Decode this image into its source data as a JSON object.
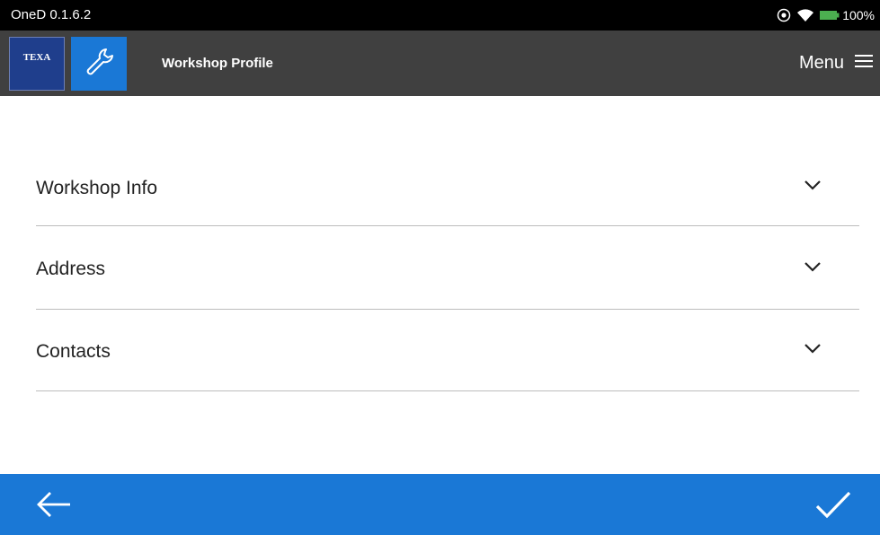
{
  "status_bar": {
    "app_version": "OneD 0.1.6.2",
    "battery_percent": "100%",
    "battery_color": "#4caf50"
  },
  "app_bar": {
    "logo_text": "TEXA",
    "title": "Workshop Profile",
    "menu_label": "Menu",
    "background": "#404040",
    "accent": "#1a78d6"
  },
  "sections": [
    {
      "label": "Workshop Info",
      "icon": "chevron-down-icon"
    },
    {
      "label": "Address",
      "icon": "chevron-down-icon"
    },
    {
      "label": "Contacts",
      "icon": "chevron-down-icon"
    }
  ],
  "bottom_bar": {
    "back_icon": "arrow-left-icon",
    "confirm_icon": "check-icon",
    "background": "#1a78d6"
  }
}
